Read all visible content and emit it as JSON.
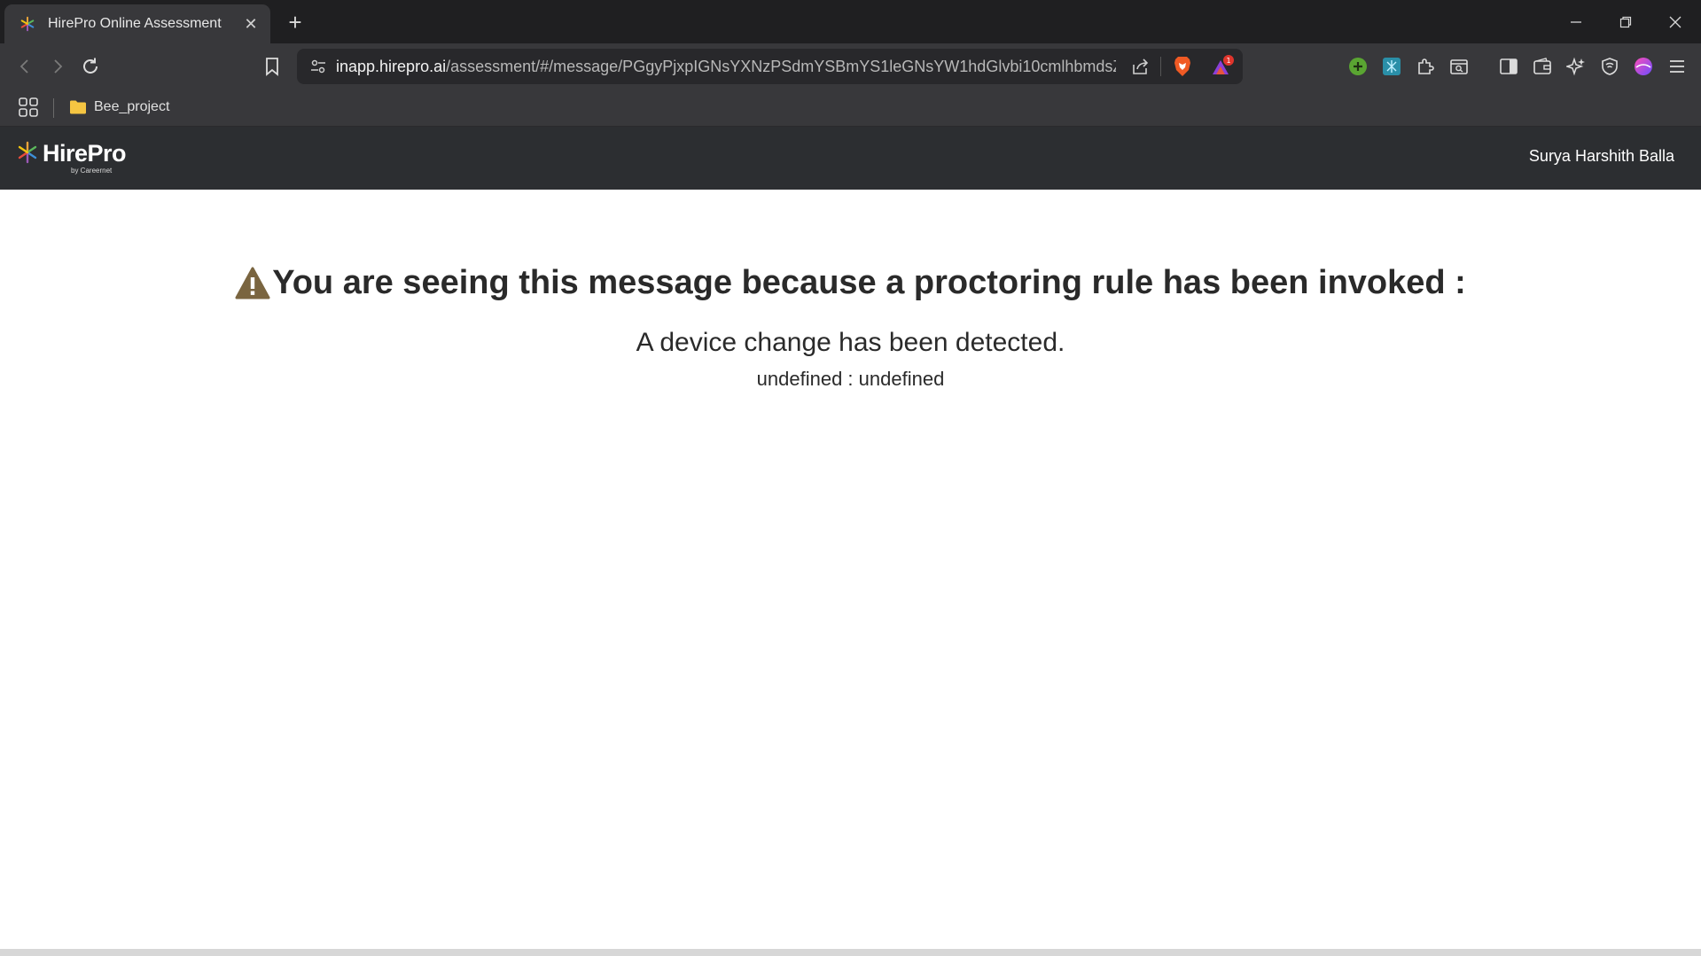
{
  "browser": {
    "tab_title": "HirePro Online Assessment",
    "url_host": "inapp.hirepro.ai",
    "url_path": "/assessment/#/message/PGgyPjxpIGNsYXNzPSdmYSBmYS1leGNsYW1hdGlvbi10cmlhbmdsZSB0...",
    "notification_count": "1",
    "bookmarks": [
      {
        "label": "Bee_project",
        "icon": "folder-icon"
      }
    ],
    "extension_icons": [
      "add-extension-icon",
      "translate-extension-icon",
      "extensions-puzzle-icon",
      "screenshot-search-icon",
      "sidebar-icon",
      "wallet-icon",
      "leo-ai-icon",
      "vpn-shield-icon",
      "profile-avatar-icon",
      "menu-icon"
    ]
  },
  "app": {
    "brand": "HirePro",
    "brand_byline": "by Careernet",
    "user_name": "Surya Harshith Balla"
  },
  "message": {
    "title": "You are seeing this message because a proctoring rule has been invoked :",
    "subtitle": "A device change has been detected.",
    "detail": "undefined : undefined",
    "warning_color": "#7a6540"
  }
}
